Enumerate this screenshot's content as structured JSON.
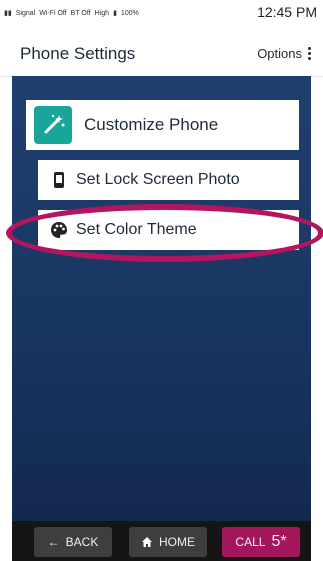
{
  "status_bar": {
    "signal": "Signal",
    "wifi": "Wi-Fi Off",
    "bt": "BT Off",
    "volume": "High",
    "battery": "100%",
    "time": "12:45 PM"
  },
  "header": {
    "title": "Phone Settings",
    "options_label": "Options"
  },
  "menu": {
    "main_item": "Customize Phone",
    "items": [
      {
        "label": "Set Lock Screen Photo",
        "icon": "phone-icon"
      },
      {
        "label": "Set Color Theme",
        "icon": "palette-icon"
      }
    ]
  },
  "bottom_nav": {
    "back_label": "BACK",
    "home_label": "HOME",
    "call_label": "CALL",
    "call_suffix": "5*"
  },
  "colors": {
    "accent": "#a4165a",
    "teal": "#1aa59b",
    "background": "#1f3f6f"
  }
}
